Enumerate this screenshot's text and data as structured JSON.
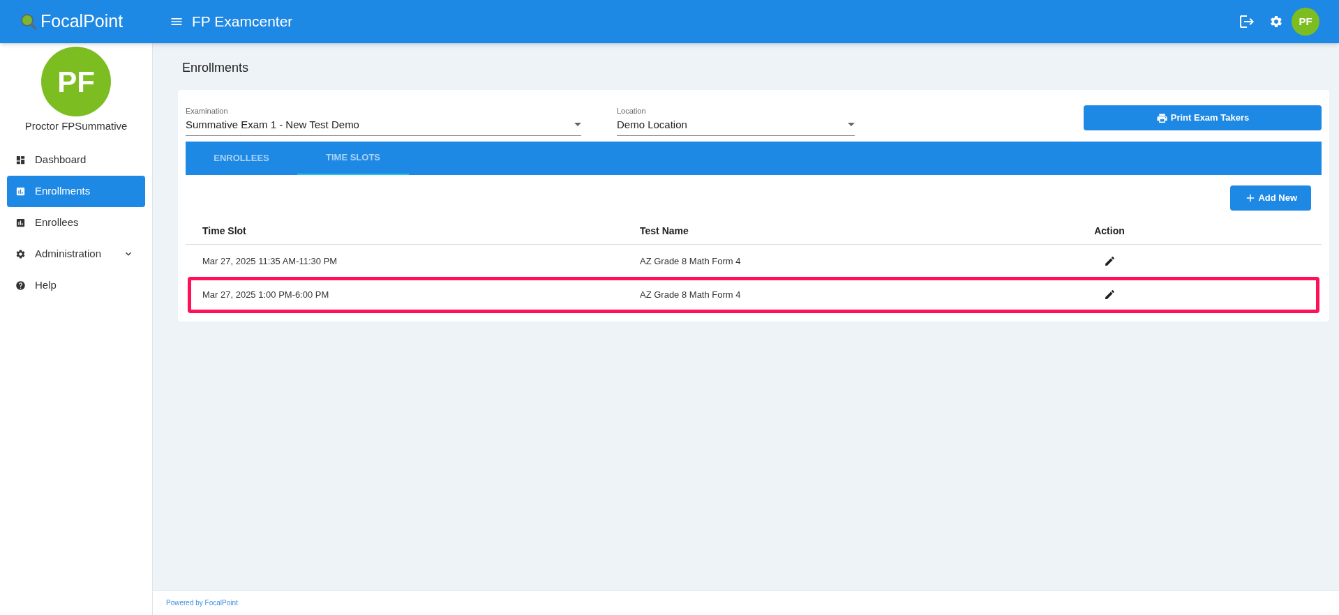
{
  "header": {
    "brand": "FocalPoint",
    "title": "FP Examcenter",
    "avatar": "PF"
  },
  "sidebar": {
    "avatar": "PF",
    "user": "Proctor FPSummative",
    "items": [
      {
        "label": "Dashboard",
        "selected": false,
        "expandable": false
      },
      {
        "label": "Enrollments",
        "selected": true,
        "expandable": false
      },
      {
        "label": "Enrollees",
        "selected": false,
        "expandable": false
      },
      {
        "label": "Administration",
        "selected": false,
        "expandable": true
      },
      {
        "label": "Help",
        "selected": false,
        "expandable": false
      }
    ]
  },
  "page_title": "Enrollments",
  "filters": [
    {
      "label": "Examination",
      "value": "Summative Exam 1 - New Test Demo"
    },
    {
      "label": "Location",
      "value": "Demo Location"
    }
  ],
  "print_button": "Print Exam Takers",
  "tabs": [
    {
      "label": "ENROLLEES",
      "selected": false
    },
    {
      "label": "TIME SLOTS",
      "selected": true
    }
  ],
  "add_button": "Add New",
  "table": {
    "columns": [
      "Time Slot",
      "Test Name",
      "Action"
    ],
    "rows": [
      {
        "time_slot": "Mar 27, 2025 11:35 AM-11:30 PM",
        "test_name": "AZ Grade 8 Math Form 4",
        "highlighted": false
      },
      {
        "time_slot": "Mar 27, 2025 1:00 PM-6:00 PM",
        "test_name": "AZ Grade 8 Math Form 4",
        "highlighted": true
      }
    ]
  },
  "footer": "Powered by FocalPoint"
}
